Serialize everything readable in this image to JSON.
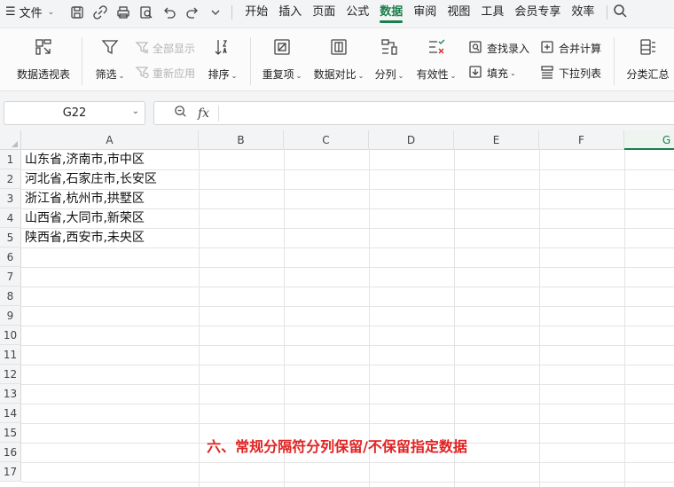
{
  "menu": {
    "file_label": "文件",
    "tabs": [
      "开始",
      "插入",
      "页面",
      "公式",
      "数据",
      "审阅",
      "视图",
      "工具",
      "会员专享",
      "效率"
    ],
    "active_tab": "数据"
  },
  "ribbon": {
    "pivot": "数据透视表",
    "filter": "筛选",
    "show_all": "全部显示",
    "reapply": "重新应用",
    "sort": "排序",
    "duplicates": "重复项",
    "compare": "数据对比",
    "split": "分列",
    "validity": "有效性",
    "lookup_entry": "查找录入",
    "fill": "填充",
    "merge_calc": "合并计算",
    "dropdown_list": "下拉列表",
    "subtotal": "分类汇总"
  },
  "formula_bar": {
    "cell_ref": "G22",
    "fx": "fx",
    "value": ""
  },
  "sheet": {
    "columns": [
      "A",
      "B",
      "C",
      "D",
      "E",
      "F",
      "G"
    ],
    "selected_column": "G",
    "rows": [
      "1",
      "2",
      "3",
      "4",
      "5",
      "6",
      "7",
      "8",
      "9",
      "10",
      "11",
      "12",
      "13",
      "14",
      "15",
      "16",
      "17"
    ],
    "cells_a": [
      "山东省,济南市,市中区",
      "河北省,石家庄市,长安区",
      "浙江省,杭州市,拱墅区",
      "山西省,大同市,新荣区",
      "陕西省,西安市,未央区"
    ]
  },
  "caption": "六、常规分隔符分列保留/不保留指定数据",
  "colors": {
    "accent": "#1a7f4b",
    "caption": "#e02222"
  }
}
